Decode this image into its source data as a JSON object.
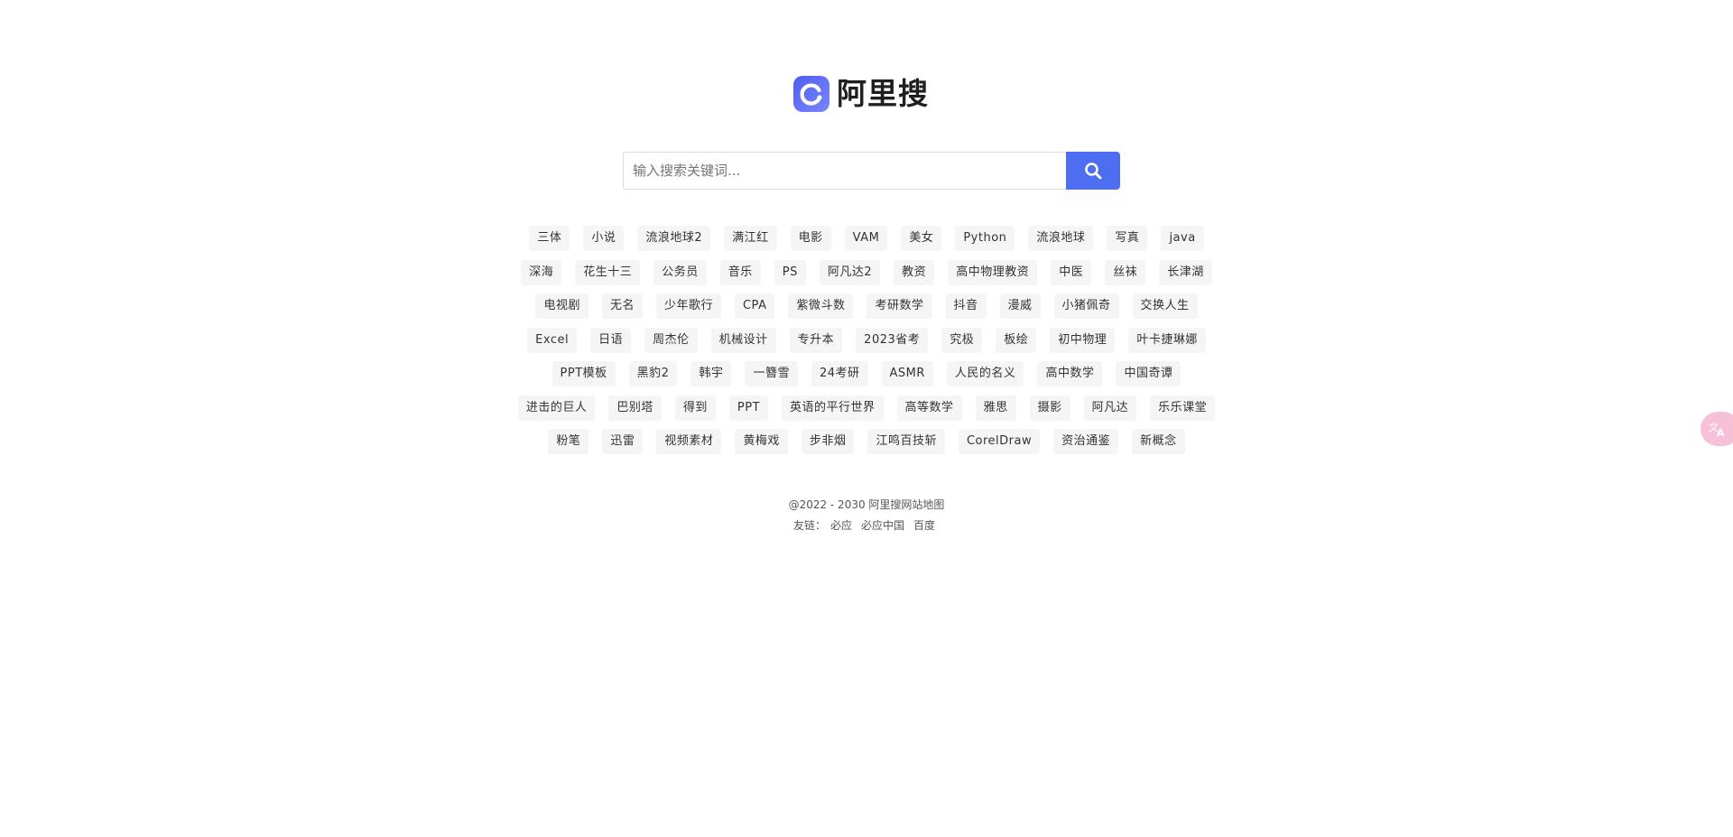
{
  "logo": {
    "text": "阿里搜",
    "icon": "refresh-circle-logo-icon"
  },
  "search": {
    "placeholder": "输入搜索关键词...",
    "value": "",
    "button_icon": "search-icon"
  },
  "colors": {
    "accent": "#4e6ef2",
    "tag_bg": "#f5f5f5",
    "float_bg": "#f6c1d8"
  },
  "tags": [
    [
      "三体",
      "小说",
      "流浪地球2",
      "满江红",
      "电影",
      "VAM",
      "美女",
      "Python",
      "流浪地球",
      "写真",
      "java"
    ],
    [
      "深海",
      "花生十三",
      "公务员",
      "音乐",
      "PS",
      "阿凡达2",
      "教资",
      "高中物理教资",
      "中医",
      "丝袜",
      "长津湖"
    ],
    [
      "电视剧",
      "无名",
      "少年歌行",
      "CPA",
      "紫微斗数",
      "考研数学",
      "抖音",
      "漫威",
      "小猪佩奇",
      "交换人生"
    ],
    [
      "Excel",
      "日语",
      "周杰伦",
      "机械设计",
      "专升本",
      "2023省考",
      "究极",
      "板绘",
      "初中物理",
      "叶卡捷琳娜"
    ],
    [
      "PPT模板",
      "黑豹2",
      "韩宇",
      "一簪雪",
      "24考研",
      "ASMR",
      "人民的名义",
      "高中数学",
      "中国奇谭"
    ],
    [
      "进击的巨人",
      "巴别塔",
      "得到",
      "PPT",
      "英语的平行世界",
      "高等数学",
      "雅思",
      "摄影",
      "阿凡达",
      "乐乐课堂"
    ],
    [
      "粉笔",
      "迅雷",
      "视频素材",
      "黄梅戏",
      "步非烟",
      "江鸣百技斩",
      "CorelDraw",
      "资治通鉴",
      "新概念"
    ]
  ],
  "footer": {
    "copyright": "@2022 - 2030 阿里搜网站地图",
    "friend_label": "友链：",
    "links": [
      "必应",
      "必应中国",
      "百度"
    ]
  },
  "floating": {
    "icon": "translate-icon"
  }
}
